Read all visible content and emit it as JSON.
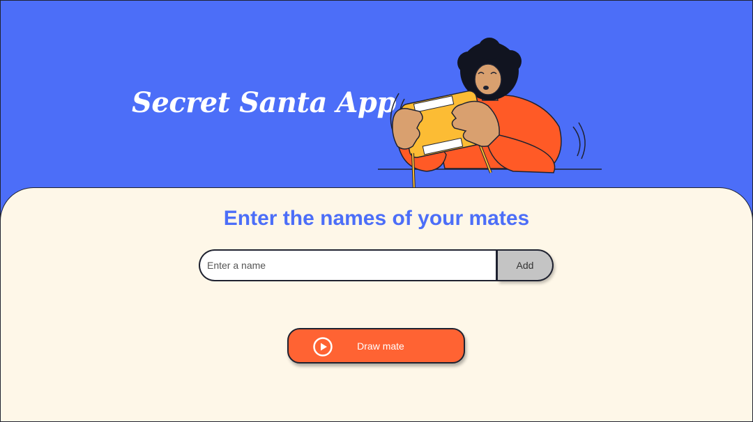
{
  "app": {
    "title": "Secret Santa App",
    "illustration_icon": "person-shaking-gift-illustration"
  },
  "main": {
    "heading": "Enter the names of your mates",
    "name_input": {
      "placeholder": "Enter a name",
      "value": ""
    },
    "add_label": "Add",
    "draw_label": "Draw mate",
    "draw_icon": "play-circle-icon"
  },
  "colors": {
    "hero_background": "#4c6ef8",
    "panel_background": "#fef7e8",
    "heading": "#4c6ef8",
    "draw_button": "#ff6333",
    "add_button": "#c4c4c4"
  }
}
